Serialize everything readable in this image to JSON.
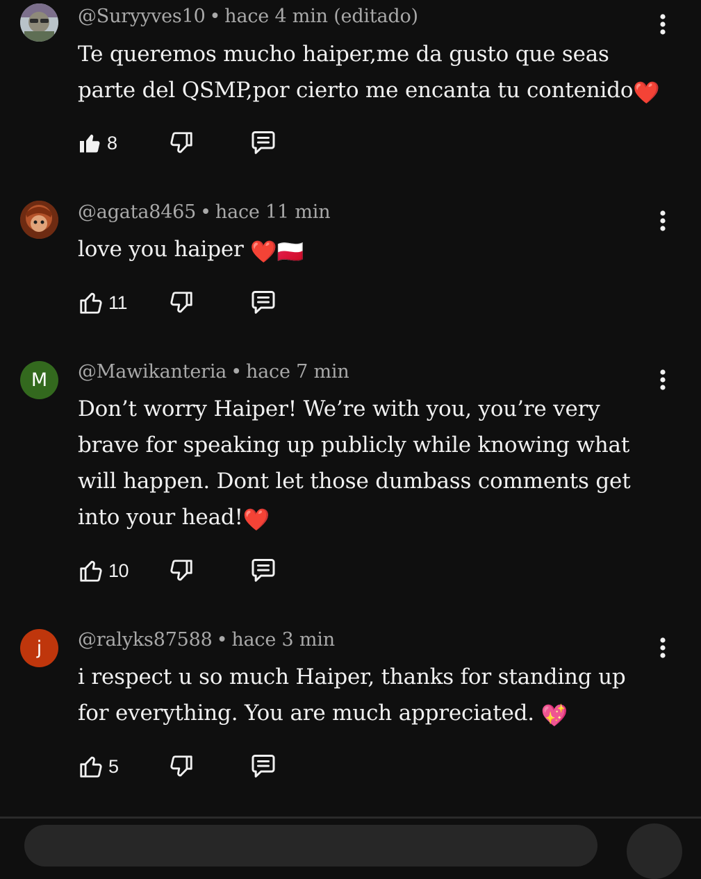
{
  "comments": [
    {
      "handle": "@Suryyves10",
      "separator": "•",
      "time": "hace 4 min (editado)",
      "text": "Te queremos mucho haiper,me da gusto que seas parte del QSMP,por cierto me encanta tu contenido",
      "emoji": "❤️",
      "likes": "8",
      "liked": true,
      "avatar": {
        "type": "image",
        "icon": "profile-photo-avatar",
        "color": "#7a8aa0"
      }
    },
    {
      "handle": "@agata8465",
      "separator": "•",
      "time": "hace 11 min",
      "text": "love you haiper ",
      "emoji": "❤️🇵🇱",
      "likes": "11",
      "liked": false,
      "avatar": {
        "type": "image",
        "icon": "profile-photo-avatar",
        "color": "#8a3a1c"
      }
    },
    {
      "handle": "@Mawikanteria",
      "separator": "•",
      "time": "hace 7 min",
      "text": "Don’t worry Haiper! We’re with you, you’re very brave for speaking up publicly while knowing what will happen. Dont let those dumbass comments get into your head!",
      "emoji": "❤️",
      "likes": "10",
      "liked": false,
      "avatar": {
        "type": "letter",
        "letter": "M",
        "color": "#33691e"
      }
    },
    {
      "handle": "@ralyks87588",
      "separator": "•",
      "time": "hace 3 min",
      "text": "i respect u so much Haiper, thanks for standing up for everything. You are much appreciated. ",
      "emoji": "💖",
      "likes": "5",
      "liked": false,
      "avatar": {
        "type": "letter",
        "letter": "j",
        "color": "#bf360c"
      }
    }
  ],
  "icons": {
    "like": "thumbs-up-icon",
    "dislike": "thumbs-down-icon",
    "reply": "reply-comment-icon",
    "menu": "more-vertical-icon"
  }
}
